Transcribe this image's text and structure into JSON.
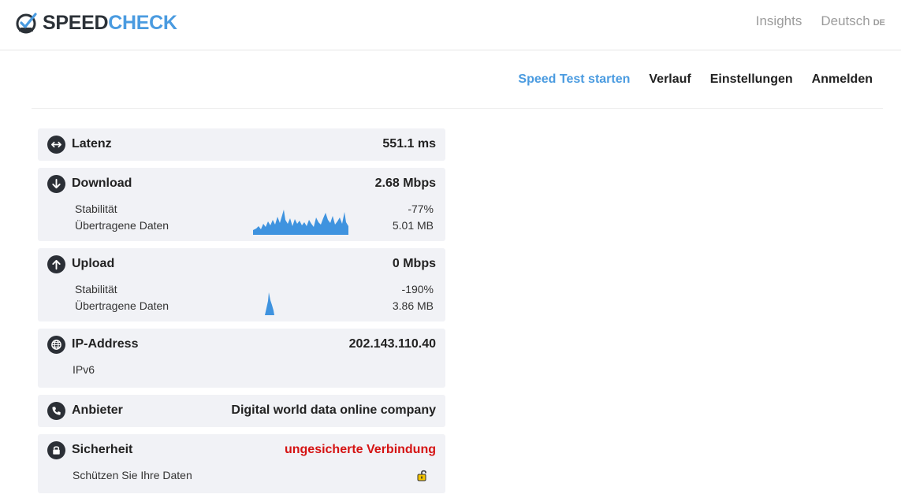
{
  "header": {
    "logo_speed": "SPEED",
    "logo_check": "CHECK",
    "insights": "Insights",
    "language": "Deutsch",
    "language_code": "DE"
  },
  "nav": {
    "items": [
      "Speed Test starten",
      "Verlauf",
      "Einstellungen",
      "Anmelden"
    ]
  },
  "results": {
    "latency": {
      "label": "Latenz",
      "value": "551.1 ms"
    },
    "download": {
      "label": "Download",
      "value": "2.68 Mbps",
      "stability_label": "Stabilität",
      "stability_value": "-77%",
      "transferred_label": "Übertragene Daten",
      "transferred_value": "5.01 MB"
    },
    "upload": {
      "label": "Upload",
      "value": "0 Mbps",
      "stability_label": "Stabilität",
      "stability_value": "-190%",
      "transferred_label": "Übertragene Daten",
      "transferred_value": "3.86 MB"
    },
    "ip": {
      "label": "IP-Address",
      "value": "202.143.110.40",
      "version": "IPv6"
    },
    "provider": {
      "label": "Anbieter",
      "value": "Digital world data online company"
    },
    "security": {
      "label": "Sicherheit",
      "value": "ungesicherte Verbindung",
      "note": "Schützen Sie Ihre Daten"
    }
  },
  "colors": {
    "accent": "#4a9be0",
    "danger": "#d51313",
    "card_bg": "#f1f2f6",
    "icon_bg": "#2b2f36"
  }
}
